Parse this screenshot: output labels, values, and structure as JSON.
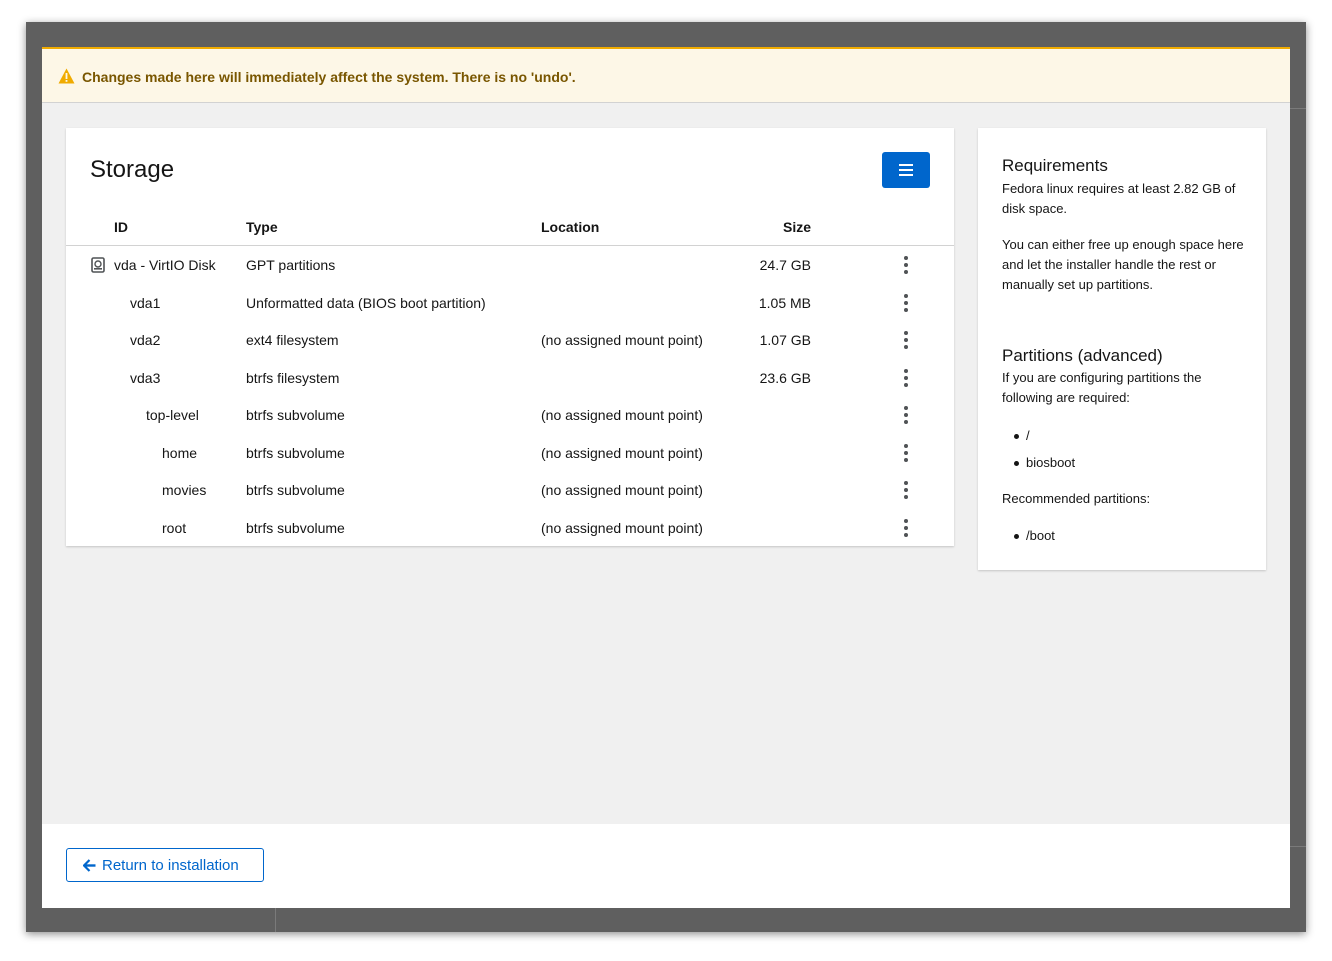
{
  "alert": {
    "text": "Changes made here will immediately affect the system. There is no 'undo'.",
    "icon": "warning-triangle-icon",
    "accent": "#f0ab00"
  },
  "storage": {
    "title": "Storage",
    "menu_icon": "hamburger-menu-icon",
    "columns": {
      "id": "ID",
      "type": "Type",
      "location": "Location",
      "size": "Size"
    },
    "rows": [
      {
        "id": "vda - VirtIO Disk",
        "type": "GPT partitions",
        "location": "",
        "size": "24.7 GB"
      },
      {
        "id": "vda1",
        "type": "Unformatted data (BIOS boot partition)",
        "location": "",
        "size": "1.05 MB"
      },
      {
        "id": "vda2",
        "type": "ext4 filesystem",
        "location": "(no assigned mount point)",
        "size": "1.07 GB"
      },
      {
        "id": "vda3",
        "type": "btrfs filesystem",
        "location": "",
        "size": "23.6 GB"
      },
      {
        "id": "top-level",
        "type": "btrfs subvolume",
        "location": "(no assigned mount point)",
        "size": ""
      },
      {
        "id": "home",
        "type": "btrfs subvolume",
        "location": "(no assigned mount point)",
        "size": ""
      },
      {
        "id": "movies",
        "type": "btrfs subvolume",
        "location": "(no assigned mount point)",
        "size": ""
      },
      {
        "id": "root",
        "type": "btrfs subvolume",
        "location": "(no assigned mount point)",
        "size": ""
      }
    ]
  },
  "sidebar": {
    "requirements_title": "Requirements",
    "requirements_text": "Fedora linux requires at least 2.82 GB of disk space.",
    "requirements_text2": "You can either free up enough space here and let the installer handle the rest or manually set up partitions.",
    "partitions_title": "Partitions (advanced)",
    "partitions_text": "If you are configuring partitions the following are required:",
    "required": [
      "/",
      "biosboot"
    ],
    "recommended_label": "Recommended partitions:",
    "recommended": [
      "/boot"
    ]
  },
  "footer": {
    "return_label": "Return to installation",
    "return_icon": "arrow-left-icon",
    "accent": "#0066cc"
  }
}
